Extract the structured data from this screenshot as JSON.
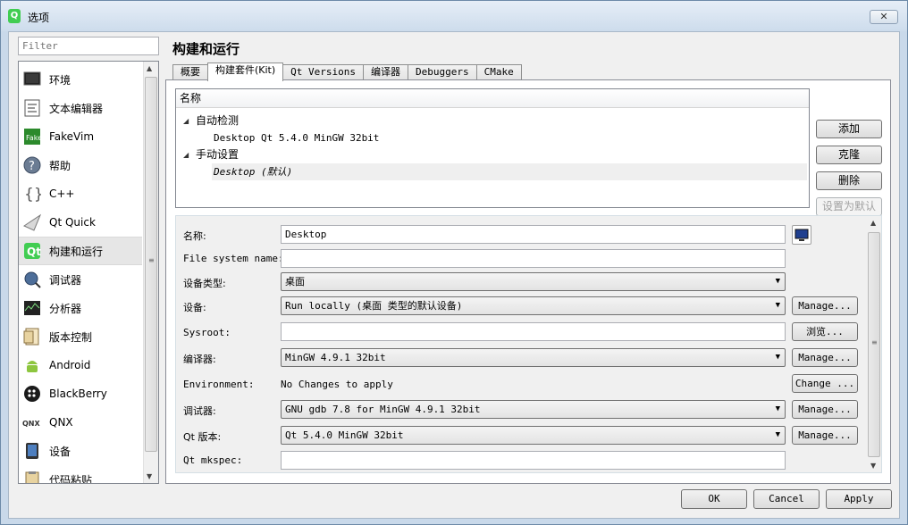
{
  "window": {
    "title": "选项",
    "close_label": "✕"
  },
  "filter": {
    "placeholder": "Filter"
  },
  "nav": {
    "items": [
      {
        "label": "环境",
        "icon": "monitor-icon"
      },
      {
        "label": "文本编辑器",
        "icon": "text-editor-icon"
      },
      {
        "label": "FakeVim",
        "icon": "fakevim-icon"
      },
      {
        "label": "帮助",
        "icon": "help-icon"
      },
      {
        "label": "C++",
        "icon": "cpp-braces-icon"
      },
      {
        "label": "Qt Quick",
        "icon": "qt-quick-icon"
      },
      {
        "label": "构建和运行",
        "icon": "build-run-icon",
        "selected": true
      },
      {
        "label": "调试器",
        "icon": "debugger-icon"
      },
      {
        "label": "分析器",
        "icon": "analyzer-icon"
      },
      {
        "label": "版本控制",
        "icon": "version-control-icon"
      },
      {
        "label": "Android",
        "icon": "android-icon"
      },
      {
        "label": "BlackBerry",
        "icon": "blackberry-icon"
      },
      {
        "label": "QNX",
        "icon": "qnx-icon"
      },
      {
        "label": "设备",
        "icon": "device-icon"
      },
      {
        "label": "代码粘贴",
        "icon": "code-paste-icon"
      }
    ]
  },
  "page": {
    "title": "构建和运行"
  },
  "tabs": [
    {
      "label": "概要"
    },
    {
      "label": "构建套件(Kit)",
      "active": true
    },
    {
      "label": "Qt Versions"
    },
    {
      "label": "编译器"
    },
    {
      "label": "Debuggers"
    },
    {
      "label": "CMake"
    }
  ],
  "kits": {
    "header": "名称",
    "groups": [
      {
        "label": "自动检测",
        "items": [
          "Desktop Qt 5.4.0 MinGW 32bit"
        ]
      },
      {
        "label": "手动设置",
        "items": [
          "Desktop (默认)"
        ]
      }
    ],
    "buttons": {
      "add": "添加",
      "clone": "克隆",
      "remove": "删除",
      "make_default": "设置为默认"
    }
  },
  "details": {
    "name": {
      "label": "名称:",
      "value": "Desktop"
    },
    "filesystem_name": {
      "label": "File system name:",
      "value": ""
    },
    "device_type": {
      "label": "设备类型:",
      "value": "桌面"
    },
    "device": {
      "label": "设备:",
      "value": "Run locally (桌面 类型的默认设备)",
      "button": "Manage..."
    },
    "sysroot": {
      "label": "Sysroot:",
      "value": "",
      "button": "浏览..."
    },
    "compiler": {
      "label": "编译器:",
      "value": "MinGW 4.9.1 32bit",
      "button": "Manage..."
    },
    "environment": {
      "label": "Environment:",
      "value": "No Changes to apply",
      "button": "Change ..."
    },
    "debugger": {
      "label": "调试器:",
      "value": "GNU gdb 7.8 for MinGW 4.9.1 32bit",
      "button": "Manage..."
    },
    "qt_version": {
      "label": "Qt 版本:",
      "value": "Qt 5.4.0 MinGW 32bit",
      "button": "Manage..."
    },
    "qt_mkspec": {
      "label": "Qt mkspec:",
      "value": ""
    }
  },
  "footer": {
    "ok": "OK",
    "cancel": "Cancel",
    "apply": "Apply"
  },
  "colors": {
    "qt_green": "#41cd52",
    "selection_gray": "#e6e6e6",
    "frame_blue": "#c9d9ea"
  }
}
